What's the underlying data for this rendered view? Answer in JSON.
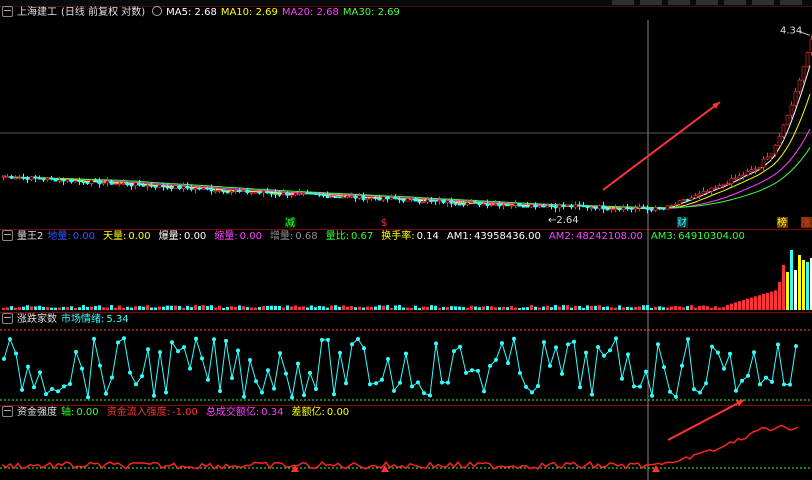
{
  "stock": {
    "name": "上海建工",
    "mode": "(日线 前复权 对数)"
  },
  "ma": [
    {
      "label": "MA5: 2.68",
      "color": "#ffffff"
    },
    {
      "label": "MA10: 2.69",
      "color": "#ffff00"
    },
    {
      "label": "MA20: 2.68",
      "color": "#ff44ff"
    },
    {
      "label": "MA30: 2.69",
      "color": "#44ff44"
    }
  ],
  "price_marks": {
    "high": "4.34",
    "low": "2.64"
  },
  "signal_labels": [
    {
      "text": "减",
      "color": "#33ff33",
      "bg": "#003300",
      "day": 72
    },
    {
      "text": "$",
      "color": "#ff3333",
      "bg": "#000000",
      "day": 96
    },
    {
      "text": "财",
      "color": "#33ffff",
      "bg": "#003333",
      "day": 170
    },
    {
      "text": "榜",
      "color": "#ffff00",
      "bg": "#663300",
      "day": 195
    },
    {
      "text": "涨",
      "color": "#ff3333",
      "bg": "#663300",
      "day": 201
    }
  ],
  "volume_panel": {
    "title": "量王2",
    "items": [
      {
        "label": "地量:",
        "value": "0.00",
        "lc": "#3355ff",
        "vc": "#3355ff"
      },
      {
        "label": "天量:",
        "value": "0.00",
        "lc": "#ffff00",
        "vc": "#ffff00"
      },
      {
        "label": "爆量:",
        "value": "0.00",
        "lc": "#ffffff",
        "vc": "#ffffff"
      },
      {
        "label": "缩量:",
        "value": "0.00",
        "lc": "#ff44ff",
        "vc": "#ff44ff"
      },
      {
        "label": "增量:",
        "value": "0.68",
        "lc": "#909090",
        "vc": "#909090"
      },
      {
        "label": "量比:",
        "value": "0.67",
        "lc": "#33ff33",
        "vc": "#33ff33"
      },
      {
        "label": "换手率:",
        "value": "0.14",
        "lc": "#ffff00",
        "vc": "#ffffff"
      },
      {
        "label": "AM1:",
        "value": "43958436.00",
        "lc": "#ffffff",
        "vc": "#ffffff"
      },
      {
        "label": "AM2:",
        "value": "48242108.00",
        "lc": "#ff44ff",
        "vc": "#ff44ff"
      },
      {
        "label": "AM3:",
        "value": "64910304.00",
        "lc": "#33ff33",
        "vc": "#33ff33"
      }
    ]
  },
  "breadth_panel": {
    "title": "涨跌家数",
    "items": [
      {
        "label": "市场情绪:",
        "value": "5.34",
        "lc": "#33ffff",
        "vc": "#33ffff"
      }
    ]
  },
  "fund_panel": {
    "title": "资金强度",
    "items": [
      {
        "label": "轴:",
        "value": "0.00",
        "lc": "#33ff33",
        "vc": "#33ff33"
      },
      {
        "label": "资金流入强度:",
        "value": "-1.00",
        "lc": "#ff3333",
        "vc": "#ff3333"
      },
      {
        "label": "总成交额亿:",
        "value": "0.34",
        "lc": "#ff44ff",
        "vc": "#ff44ff"
      },
      {
        "label": "差额亿:",
        "value": "0.00",
        "lc": "#ffff00",
        "vc": "#ffff00"
      }
    ]
  },
  "chart_data": [
    {
      "type": "candlestick",
      "panel": "price",
      "series": [
        {
          "name": "MA5"
        },
        {
          "name": "MA10"
        },
        {
          "name": "MA20"
        },
        {
          "name": "MA30"
        }
      ]
    },
    {
      "type": "bar",
      "panel": "volume",
      "series": [
        {
          "name": "地量"
        },
        {
          "name": "天量"
        },
        {
          "name": "爆量"
        }
      ]
    },
    {
      "type": "line",
      "panel": "breadth",
      "series": [
        {
          "name": "市场情绪",
          "color": "#33ffff"
        }
      ]
    },
    {
      "type": "line",
      "panel": "fund",
      "series": [
        {
          "name": "资金流入强度",
          "color": "#ff2222"
        }
      ]
    }
  ]
}
